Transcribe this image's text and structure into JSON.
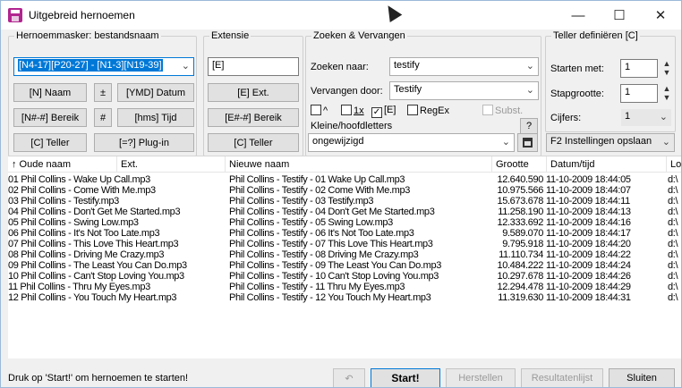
{
  "window": {
    "title": "Uitgebreid hernoemen",
    "minimize_glyph": "—",
    "maximize_glyph": "☐",
    "close_glyph": "✕"
  },
  "mask_group": {
    "label": "Hernoemmasker: bestandsnaam",
    "mask_value": "[N4-17][P20-27] - [N1-3][N19-39]",
    "buttons": [
      {
        "label": "[N] Naam"
      },
      {
        "label": "±"
      },
      {
        "label": "[YMD] Datum"
      },
      {
        "label": "[N#-#] Bereik"
      },
      {
        "label": "#"
      },
      {
        "label": "[hms] Tijd"
      },
      {
        "label": "[C] Teller"
      },
      {
        "label": "[=?] Plug-in"
      }
    ]
  },
  "extension_group": {
    "label": "Extensie",
    "value": "[E]",
    "buttons": [
      {
        "label": "[E] Ext."
      },
      {
        "label": "[E#-#] Bereik"
      },
      {
        "label": "[C] Teller"
      }
    ]
  },
  "search_group": {
    "label": "Zoeken & Vervangen",
    "search_label": "Zoeken naar:",
    "search_value": "testify",
    "replace_label": "Vervangen door:",
    "replace_value": "Testify",
    "option_caret": "^",
    "option_1x": "1x",
    "option_e": "[E]",
    "option_regex": "RegEx",
    "option_subst": "Subst.",
    "help_label": "?",
    "case_label": "Kleine/hoofdletters",
    "case_value": "ongewijzigd"
  },
  "counter_group": {
    "label": "Teller definiëren [C]",
    "start_label": "Starten met:",
    "start_value": "1",
    "step_label": "Stapgrootte:",
    "step_value": "1",
    "digits_label": "Cijfers:",
    "digits_value": "1",
    "save_settings": "F2 Instellingen opslaan"
  },
  "table": {
    "columns": [
      "↑ Oude naam",
      "Ext.",
      "Nieuwe naam",
      "Grootte",
      "Datum/tijd",
      "Loc"
    ],
    "rows": [
      {
        "old": "01 Phil Collins - Wake Up Call.mp3",
        "new": "Phil Collins - Testify - 01 Wake Up Call.mp3",
        "size": "12.640.590",
        "date": "11-10-2009 18:44:05",
        "loc": "d:\\"
      },
      {
        "old": "02 Phil Collins - Come With Me.mp3",
        "new": "Phil Collins - Testify - 02 Come With Me.mp3",
        "size": "10.975.566",
        "date": "11-10-2009 18:44:07",
        "loc": "d:\\"
      },
      {
        "old": "03 Phil Collins - Testify.mp3",
        "new": "Phil Collins - Testify - 03 Testify.mp3",
        "size": "15.673.678",
        "date": "11-10-2009 18:44:11",
        "loc": "d:\\"
      },
      {
        "old": "04 Phil Collins - Don't Get Me Started.mp3",
        "new": "Phil Collins - Testify - 04 Don't Get Me Started.mp3",
        "size": "11.258.190",
        "date": "11-10-2009 18:44:13",
        "loc": "d:\\"
      },
      {
        "old": "05 Phil Collins - Swing Low.mp3",
        "new": "Phil Collins - Testify - 05 Swing Low.mp3",
        "size": "12.333.692",
        "date": "11-10-2009 18:44:16",
        "loc": "d:\\"
      },
      {
        "old": "06 Phil Collins - It's Not Too Late.mp3",
        "new": "Phil Collins - Testify - 06 It's Not Too Late.mp3",
        "size": "9.589.070",
        "date": "11-10-2009 18:44:17",
        "loc": "d:\\"
      },
      {
        "old": "07 Phil Collins - This Love This Heart.mp3",
        "new": "Phil Collins - Testify - 07 This Love This Heart.mp3",
        "size": "9.795.918",
        "date": "11-10-2009 18:44:20",
        "loc": "d:\\"
      },
      {
        "old": "08 Phil Collins - Driving Me Crazy.mp3",
        "new": "Phil Collins - Testify - 08 Driving Me Crazy.mp3",
        "size": "11.110.734",
        "date": "11-10-2009 18:44:22",
        "loc": "d:\\"
      },
      {
        "old": "09 Phil Collins - The Least You Can Do.mp3",
        "new": "Phil Collins - Testify - 09 The Least You Can Do.mp3",
        "size": "10.484.222",
        "date": "11-10-2009 18:44:24",
        "loc": "d:\\"
      },
      {
        "old": "10 Phil Collins - Can't Stop Loving You.mp3",
        "new": "Phil Collins - Testify - 10 Can't Stop Loving You.mp3",
        "size": "10.297.678",
        "date": "11-10-2009 18:44:26",
        "loc": "d:\\"
      },
      {
        "old": "11 Phil Collins - Thru My Eyes.mp3",
        "new": "Phil Collins - Testify - 11 Thru My Eyes.mp3",
        "size": "12.294.478",
        "date": "11-10-2009 18:44:29",
        "loc": "d:\\"
      },
      {
        "old": "12 Phil Collins - You Touch My Heart.mp3",
        "new": "Phil Collins - Testify - 12 You Touch My Heart.mp3",
        "size": "11.319.630",
        "date": "11-10-2009 18:44:31",
        "loc": "d:\\"
      }
    ]
  },
  "status": {
    "text": "Druk op 'Start!' om hernoemen te starten!",
    "undo_glyph": "↶",
    "start_label": "Start!",
    "reset_label": "Herstellen",
    "results_label": "Resultatenlijst",
    "close_label": "Sluiten"
  },
  "colors": {
    "title_icon": "#b1258f",
    "selection": "#0078d7",
    "window_bg": "#f0f0f0"
  }
}
